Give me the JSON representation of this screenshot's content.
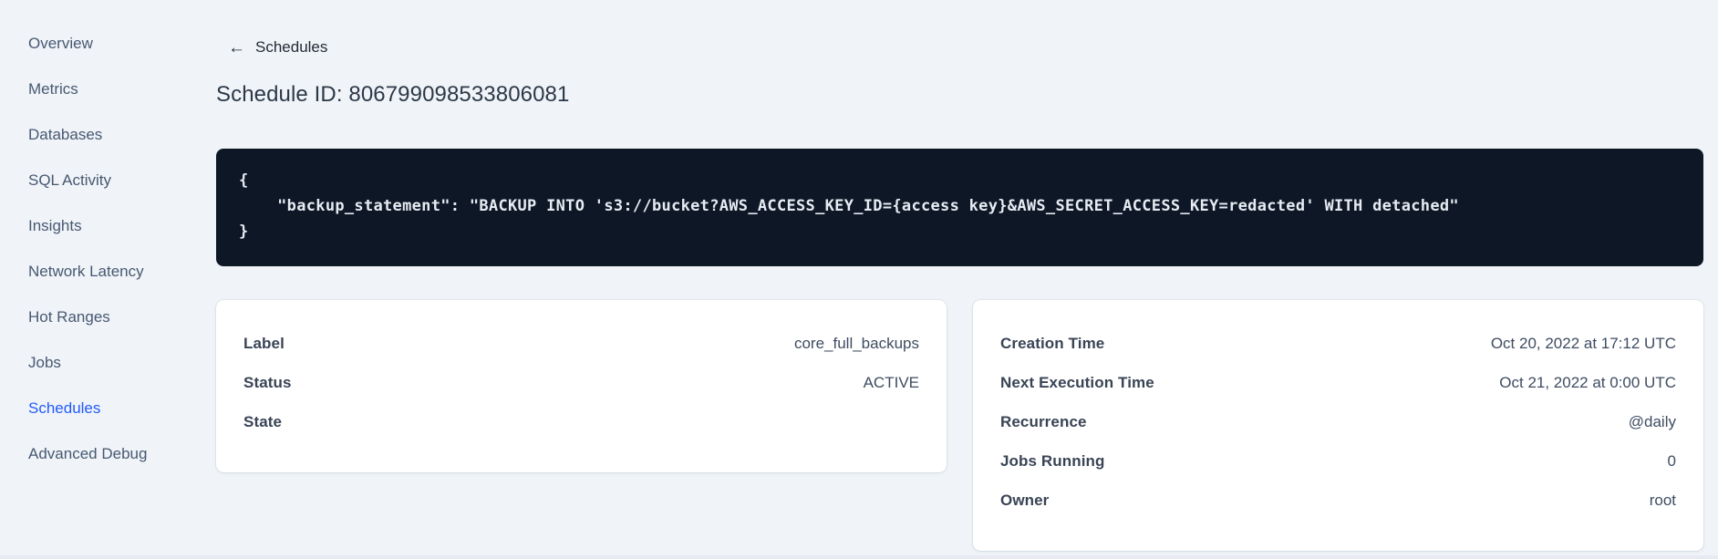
{
  "sidebar": {
    "items": [
      {
        "label": "Overview"
      },
      {
        "label": "Metrics"
      },
      {
        "label": "Databases"
      },
      {
        "label": "SQL Activity"
      },
      {
        "label": "Insights"
      },
      {
        "label": "Network Latency"
      },
      {
        "label": "Hot Ranges"
      },
      {
        "label": "Jobs"
      },
      {
        "label": "Schedules",
        "active": true
      },
      {
        "label": "Advanced Debug"
      }
    ],
    "active_color": "#235afa",
    "text_color": "#475872"
  },
  "header": {
    "back_arrow": "←",
    "back_label": "Schedules",
    "title": "Schedule ID: 806799098533806081"
  },
  "code_block": {
    "content": "{\n    \"backup_statement\": \"BACKUP INTO 's3://bucket?AWS_ACCESS_KEY_ID={access key}&AWS_SECRET_ACCESS_KEY=redacted' WITH detached\"\n}",
    "background": "#0e1726",
    "text_color": "#e7ecf3"
  },
  "schedule_details": {
    "rows": [
      {
        "label": "Label",
        "value": "core_full_backups"
      },
      {
        "label": "Status",
        "value": "ACTIVE"
      },
      {
        "label": "State",
        "value": ""
      }
    ]
  },
  "execution_details": {
    "rows": [
      {
        "label": "Creation Time",
        "value": "Oct 20, 2022 at 17:12 UTC"
      },
      {
        "label": "Next Execution Time",
        "value": "Oct 21, 2022 at 0:00 UTC"
      },
      {
        "label": "Recurrence",
        "value": "@daily"
      },
      {
        "label": "Jobs Running",
        "value": "0"
      },
      {
        "label": "Owner",
        "value": "root"
      }
    ]
  },
  "colors": {
    "page_background": "#f0f4f8",
    "card_background": "#ffffff",
    "title_text": "#2c3848",
    "label_text": "#394455"
  }
}
